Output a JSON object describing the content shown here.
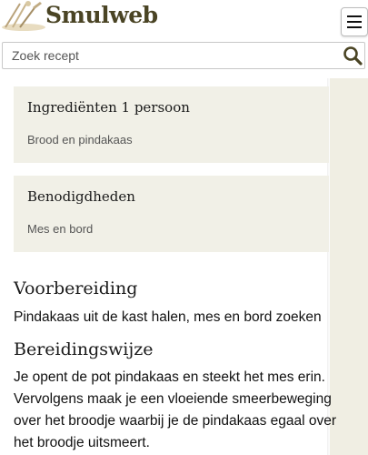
{
  "header": {
    "site_name": "Smulweb",
    "logo_icon": "utensils-icon",
    "menu_icon": "hamburger-menu-icon"
  },
  "search": {
    "placeholder": "Zoek recept",
    "icon": "search-icon"
  },
  "recipe": {
    "ingredients": {
      "title": "Ingrediënten 1 persoon",
      "text": "Brood en pindakaas"
    },
    "equipment": {
      "title": "Benodigdheden",
      "text": "Mes en bord"
    },
    "preparation": {
      "title": "Voorbereiding",
      "text": "Pindakaas uit de kast halen, mes en bord zoeken"
    },
    "method": {
      "title": "Bereidingswijze",
      "text": "Je opent de pot pindakaas en steekt het mes erin. Vervolgens maak je een vloeiende smeerbeweging over het broodje waarbij je de pindakaas egaal over het broodje uitsmeert."
    }
  },
  "colors": {
    "logo_text": "#4a4424",
    "card_background": "#f1f0e7",
    "side_panel": "#f0eee3"
  }
}
